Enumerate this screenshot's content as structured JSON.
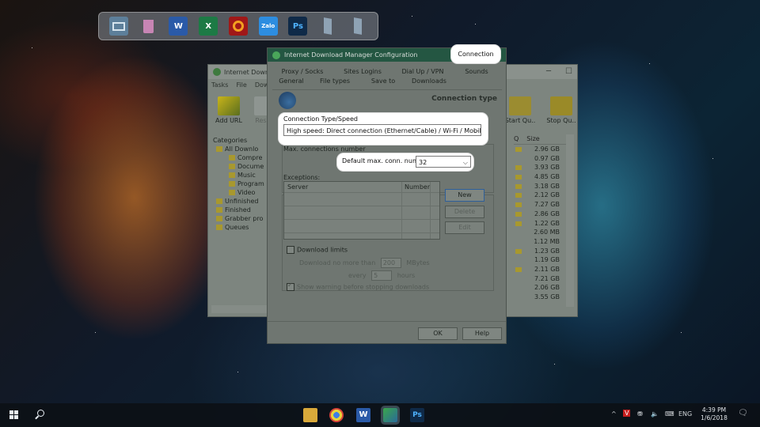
{
  "desktop": {
    "dock_icons": [
      "monitor-icon",
      "recycle-bin-icon",
      "word-icon",
      "excel-icon",
      "garena-icon",
      "zalo-icon",
      "photoshop-icon",
      "window-icon",
      "window-icon"
    ],
    "dock_labels": {
      "word": "W",
      "excel": "X",
      "zalo": "Zalo",
      "photoshop": "Ps"
    }
  },
  "idm_main": {
    "title": "Internet Down",
    "menu": [
      "Tasks",
      "File",
      "Dow"
    ],
    "toolbar": {
      "add_url": "Add URL",
      "resume": "Resu",
      "start_queue": "Start Qu..",
      "stop_queue": "Stop Qu.."
    },
    "categories_header": "Categories",
    "categories": [
      {
        "label": "All Downlo",
        "indent": 1
      },
      {
        "label": "Compre",
        "indent": 2
      },
      {
        "label": "Docume",
        "indent": 2
      },
      {
        "label": "Music",
        "indent": 2
      },
      {
        "label": "Program",
        "indent": 2
      },
      {
        "label": "Video",
        "indent": 2
      },
      {
        "label": "Unfinished",
        "indent": 1
      },
      {
        "label": "Finished",
        "indent": 1
      },
      {
        "label": "Grabber pro",
        "indent": 1
      },
      {
        "label": "Queues",
        "indent": 1
      }
    ],
    "columns": {
      "q": "Q",
      "size": "Size"
    },
    "sizes": [
      {
        "value": "2.96 GB",
        "folder": true
      },
      {
        "value": "0.97 GB",
        "folder": false
      },
      {
        "value": "3.93 GB",
        "folder": true
      },
      {
        "value": "4.85 GB",
        "folder": true
      },
      {
        "value": "3.18 GB",
        "folder": true
      },
      {
        "value": "2.12 GB",
        "folder": true
      },
      {
        "value": "7.27 GB",
        "folder": true
      },
      {
        "value": "2.86 GB",
        "folder": true
      },
      {
        "value": "1.22 GB",
        "folder": true
      },
      {
        "value": "2.60 MB",
        "folder": false
      },
      {
        "value": "1.12 MB",
        "folder": false
      },
      {
        "value": "1.23 GB",
        "folder": true
      },
      {
        "value": "1.19 GB",
        "folder": false
      },
      {
        "value": "2.11 GB",
        "folder": true
      },
      {
        "value": "7.21 GB",
        "folder": false
      },
      {
        "value": "2.06 GB",
        "folder": false
      },
      {
        "value": "3.55 GB",
        "folder": false
      }
    ],
    "window_buttons": [
      "─",
      "☐"
    ]
  },
  "config_dialog": {
    "title": "Internet Download Manager Configuration",
    "close": "✕",
    "tabs_row1": [
      "Proxy / Socks",
      "Sites Logins",
      "Dial Up / VPN",
      "Sounds"
    ],
    "tabs_row2": [
      "General",
      "File types",
      "Save to",
      "Downloads"
    ],
    "active_tab": "Connection",
    "section_header": "Connection type",
    "connection_type_label": "Connection Type/Speed",
    "connection_type_value": "High speed: Direct connection (Ethernet/Cable) / Wi-Fi / Mobile 4G / ot",
    "max_connections_label": "Max. connections number",
    "default_max_label": "Default max. conn. number",
    "default_max_value": "32",
    "exceptions_label": "Exceptions:",
    "exceptions_columns": {
      "server": "Server",
      "number": "Number"
    },
    "buttons": {
      "new": "New",
      "delete": "Delete",
      "edit": "Edit"
    },
    "download_limits": {
      "label": "Download limits",
      "no_more_than": "Download no more than",
      "amount": "200",
      "unit": "MBytes",
      "every": "every",
      "hours_value": "5",
      "hours": "hours",
      "warning": "Show warning before stopping downloads"
    },
    "ok": "OK",
    "help": "Help"
  },
  "taskbar": {
    "apps": [
      "file-explorer-icon",
      "chrome-icon",
      "word-icon",
      "idm-icon",
      "photoshop-icon"
    ],
    "word_label": "W",
    "ps_label": "Ps",
    "lang": "ENG",
    "time": "4:39 PM",
    "date": "1/6/2018",
    "tray_chevron": "^",
    "tray_v": "V",
    "notification": "🗨"
  },
  "colors": {
    "dialog_title_bar": "#245642",
    "highlight": "#ffffff",
    "taskbar": "#0c1016"
  }
}
